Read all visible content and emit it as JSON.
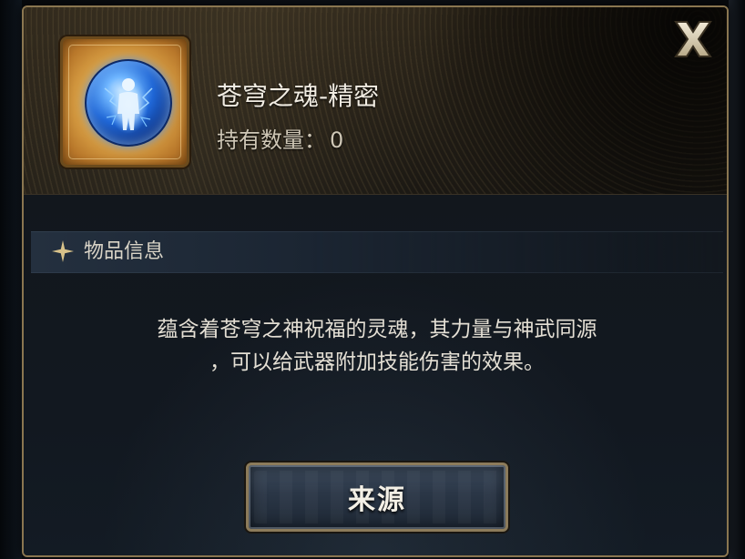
{
  "item": {
    "name": "苍穹之魂-精密",
    "count_label": "持有数量：",
    "count_value": "0",
    "icon": "blue-soul-orb-icon"
  },
  "dialog": {
    "close_icon": "close-x-icon",
    "close_glyph": "X"
  },
  "section": {
    "icon": "sparkle-star-icon",
    "label": "物品信息"
  },
  "description": {
    "line1": "蕴含着苍穹之神祝福的灵魂，其力量与神武同源",
    "line2": "，可以给武器附加技能伤害的效果。"
  },
  "actions": {
    "source_label": "来源"
  },
  "colors": {
    "frame_gold": "#8a7650",
    "orb_blue": "#1f66d6",
    "text_primary": "#f1ece2",
    "button_blue": "#2a3646"
  }
}
